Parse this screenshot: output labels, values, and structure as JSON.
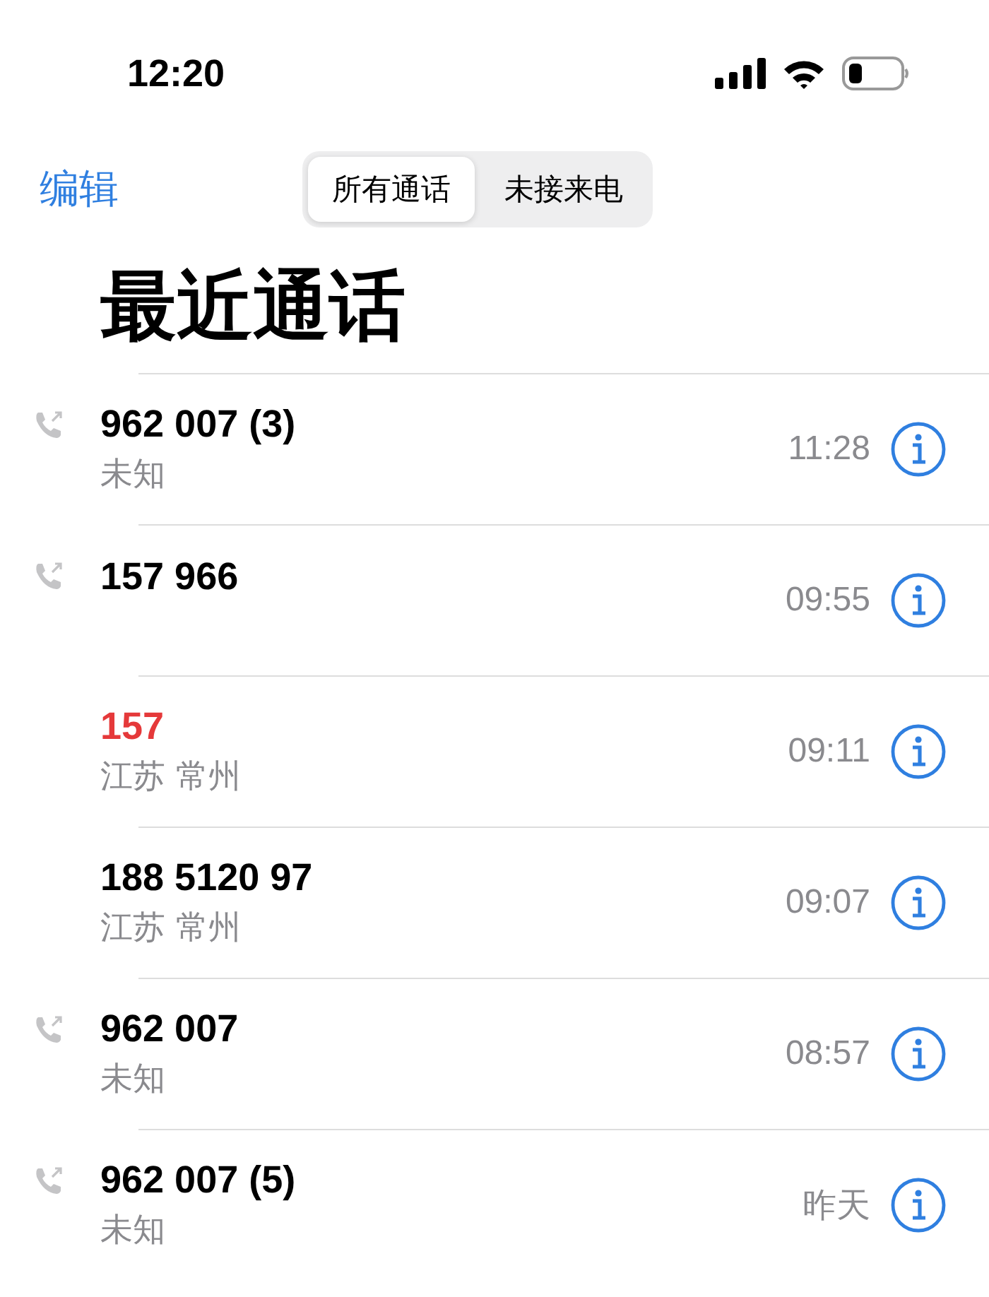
{
  "status_bar": {
    "time": "12:20"
  },
  "nav": {
    "edit": "编辑",
    "tabs": [
      {
        "label": "所有通话",
        "selected": true
      },
      {
        "label": "未接来电",
        "selected": false
      }
    ]
  },
  "title": "最近通话",
  "calls": [
    {
      "number": "962 007 (3)",
      "location": "未知",
      "time": "11:28",
      "outgoing": true,
      "missed": false
    },
    {
      "number": "157 966",
      "time": "09:55",
      "outgoing": true,
      "missed": false
    },
    {
      "number": "157",
      "location": "江苏 常州",
      "time": "09:11",
      "outgoing": false,
      "missed": true
    },
    {
      "number": "188 5120 97",
      "location": "江苏 常州",
      "time": "09:07",
      "outgoing": false,
      "missed": false
    },
    {
      "number": "962 007",
      "location": "未知",
      "time": "08:57",
      "outgoing": true,
      "missed": false
    },
    {
      "number": "962 007 (5)",
      "location": "未知",
      "time": "昨天",
      "outgoing": true,
      "missed": false
    }
  ]
}
